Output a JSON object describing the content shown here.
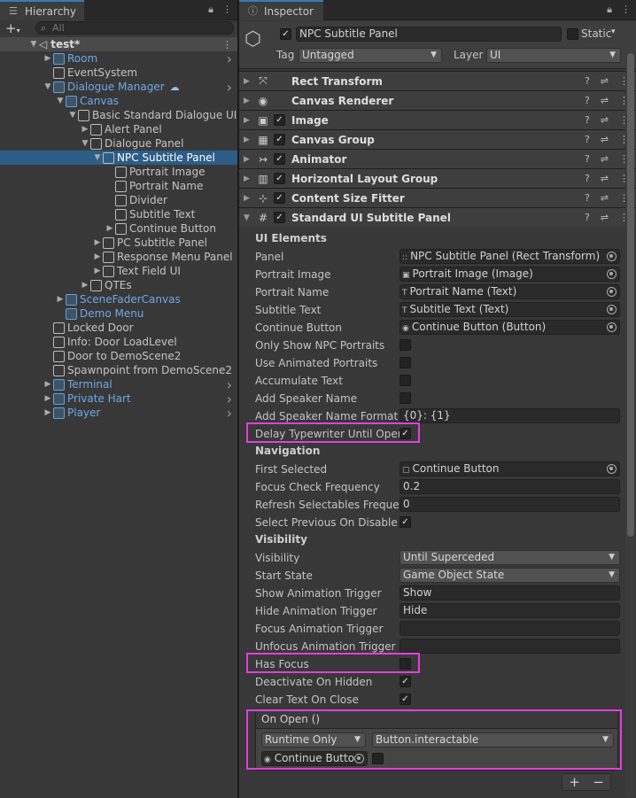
{
  "hierarchy": {
    "tab_label": "Hierarchy",
    "add_label": "+",
    "search_placeholder": "All",
    "scene": "test*",
    "items": [
      {
        "label": "Room",
        "depth": 0,
        "color": "blue",
        "expand": "closed",
        "chevron": true
      },
      {
        "label": "EventSystem",
        "depth": 0,
        "color": "normal",
        "expand": "none"
      },
      {
        "label": "Dialogue Manager",
        "depth": 0,
        "color": "blue",
        "expand": "open",
        "chevron": true,
        "cloud": true
      },
      {
        "label": "Canvas",
        "depth": 1,
        "color": "blue",
        "expand": "open"
      },
      {
        "label": "Basic Standard Dialogue UI",
        "depth": 2,
        "color": "normal",
        "expand": "open"
      },
      {
        "label": "Alert Panel",
        "depth": 3,
        "color": "normal",
        "expand": "closed"
      },
      {
        "label": "Dialogue Panel",
        "depth": 3,
        "color": "normal",
        "expand": "open"
      },
      {
        "label": "NPC Subtitle Panel",
        "depth": 4,
        "color": "selected",
        "expand": "open",
        "selected": true
      },
      {
        "label": "Portrait Image",
        "depth": 5,
        "color": "normal",
        "expand": "none"
      },
      {
        "label": "Portrait Name",
        "depth": 5,
        "color": "normal",
        "expand": "none"
      },
      {
        "label": "Divider",
        "depth": 5,
        "color": "normal",
        "expand": "none"
      },
      {
        "label": "Subtitle Text",
        "depth": 5,
        "color": "normal",
        "expand": "none"
      },
      {
        "label": "Continue Button",
        "depth": 5,
        "color": "normal",
        "expand": "closed"
      },
      {
        "label": "PC Subtitle Panel",
        "depth": 4,
        "color": "normal",
        "expand": "closed"
      },
      {
        "label": "Response Menu Panel",
        "depth": 4,
        "color": "normal",
        "expand": "closed"
      },
      {
        "label": "Text Field UI",
        "depth": 4,
        "color": "normal",
        "expand": "closed"
      },
      {
        "label": "QTEs",
        "depth": 3,
        "color": "normal",
        "expand": "closed"
      },
      {
        "label": "SceneFaderCanvas",
        "depth": 1,
        "color": "blue",
        "expand": "closed"
      },
      {
        "label": "Demo Menu",
        "depth": 1,
        "color": "blue",
        "expand": "none"
      },
      {
        "label": "Locked Door",
        "depth": 0,
        "color": "normal",
        "expand": "none"
      },
      {
        "label": "Info: Door LoadLevel",
        "depth": 0,
        "color": "normal",
        "expand": "none"
      },
      {
        "label": "Door to DemoScene2",
        "depth": 0,
        "color": "normal",
        "expand": "none"
      },
      {
        "label": "Spawnpoint from DemoScene2",
        "depth": 0,
        "color": "normal",
        "expand": "none"
      },
      {
        "label": "Terminal",
        "depth": 0,
        "color": "blue",
        "expand": "closed",
        "chevron": true
      },
      {
        "label": "Private Hart",
        "depth": 0,
        "color": "blue",
        "expand": "closed",
        "chevron": true
      },
      {
        "label": "Player",
        "depth": 0,
        "color": "blue",
        "expand": "closed",
        "chevron": true
      }
    ]
  },
  "inspector": {
    "tab_label": "Inspector",
    "object_name": "NPC Subtitle Panel",
    "static_label": "Static",
    "tag_label": "Tag",
    "tag_value": "Untagged",
    "layer_label": "Layer",
    "layer_value": "UI",
    "components": [
      {
        "name": "Rect Transform",
        "icon": "move-arrows-icon",
        "glyph": "⤧",
        "checkbox": false
      },
      {
        "name": "Canvas Renderer",
        "icon": "eye-icon",
        "glyph": "◉",
        "checkbox": false
      },
      {
        "name": "Image",
        "icon": "image-icon",
        "glyph": "▣",
        "checkbox": true
      },
      {
        "name": "Canvas Group",
        "icon": "grid-icon",
        "glyph": "▦",
        "checkbox": true
      },
      {
        "name": "Animator",
        "icon": "animator-icon",
        "glyph": "↣",
        "checkbox": true
      },
      {
        "name": "Horizontal Layout Group",
        "icon": "layout-icon",
        "glyph": "▥",
        "checkbox": true
      },
      {
        "name": "Content Size Fitter",
        "icon": "fitter-icon",
        "glyph": "⊹",
        "checkbox": true
      },
      {
        "name": "Standard UI Subtitle Panel",
        "icon": "script-icon",
        "glyph": "#",
        "checkbox": true,
        "expanded": true
      }
    ],
    "sections": {
      "ui_elements": "UI Elements",
      "navigation": "Navigation",
      "visibility": "Visibility"
    },
    "props": {
      "panel": {
        "label": "Panel",
        "value": "NPC Subtitle Panel (Rect Transform)",
        "icon": "::"
      },
      "portrait_image": {
        "label": "Portrait Image",
        "value": "Portrait Image (Image)",
        "icon": "▣"
      },
      "portrait_name": {
        "label": "Portrait Name",
        "value": "Portrait Name (Text)",
        "icon": "T"
      },
      "subtitle_text": {
        "label": "Subtitle Text",
        "value": "Subtitle Text (Text)",
        "icon": "T"
      },
      "continue_button": {
        "label": "Continue Button",
        "value": "Continue Button (Button)",
        "icon": "◉"
      },
      "only_npc_portraits": {
        "label": "Only Show NPC Portraits",
        "checked": false
      },
      "animated_portraits": {
        "label": "Use Animated Portraits",
        "checked": false
      },
      "accumulate_text": {
        "label": "Accumulate Text",
        "checked": false
      },
      "add_speaker_name": {
        "label": "Add Speaker Name",
        "checked": false
      },
      "speaker_name_format": {
        "label": "Add Speaker Name Format",
        "value": "{0}: {1}"
      },
      "delay_typewriter": {
        "label": "Delay Typewriter Until Open",
        "checked": true
      },
      "first_selected": {
        "label": "First Selected",
        "value": "Continue Button",
        "icon": "▢"
      },
      "focus_check_frequency": {
        "label": "Focus Check Frequency",
        "value": "0.2"
      },
      "refresh_selectables": {
        "label": "Refresh Selectables Frequen",
        "value": "0"
      },
      "select_previous": {
        "label": "Select Previous On Disable",
        "checked": true
      },
      "visibility_mode": {
        "label": "Visibility",
        "value": "Until Superceded"
      },
      "start_state": {
        "label": "Start State",
        "value": "Game Object State"
      },
      "show_anim": {
        "label": "Show Animation Trigger",
        "value": "Show"
      },
      "hide_anim": {
        "label": "Hide Animation Trigger",
        "value": "Hide"
      },
      "focus_anim": {
        "label": "Focus Animation Trigger",
        "value": ""
      },
      "unfocus_anim": {
        "label": "Unfocus Animation Trigger",
        "value": ""
      },
      "has_focus": {
        "label": "Has Focus",
        "checked": false
      },
      "deactivate_hidden": {
        "label": "Deactivate On Hidden",
        "checked": true
      },
      "clear_text": {
        "label": "Clear Text On Close",
        "checked": true
      }
    },
    "on_open": {
      "header": "On Open ()",
      "runtime": "Runtime Only",
      "function": "Button.interactable",
      "target": "Continue Butto",
      "value_checked": false
    },
    "plus_label": "+",
    "minus_label": "−"
  },
  "colors": {
    "highlight": "#e43de0",
    "selection": "#2c5d87",
    "accent_blue": "#6fa8e6"
  }
}
